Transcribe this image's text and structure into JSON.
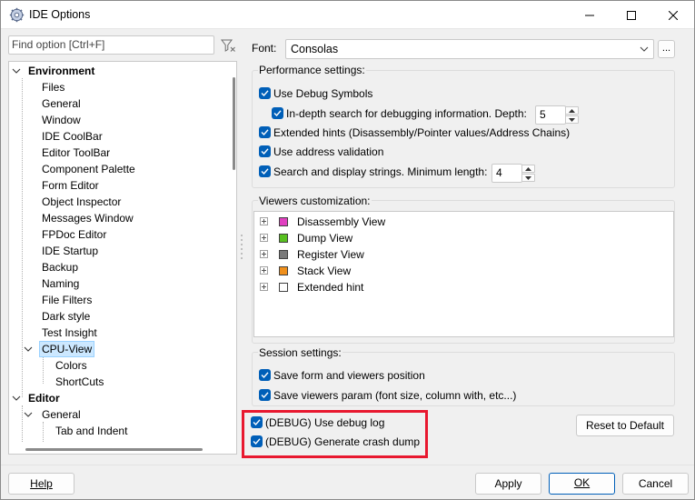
{
  "window": {
    "title": "IDE Options"
  },
  "left": {
    "search_placeholder": "Find option [Ctrl+F]",
    "tree": [
      {
        "label": "Environment",
        "level": 0,
        "bold": true,
        "expanded": true
      },
      {
        "label": "Files",
        "level": 1
      },
      {
        "label": "General",
        "level": 1
      },
      {
        "label": "Window",
        "level": 1
      },
      {
        "label": "IDE CoolBar",
        "level": 1
      },
      {
        "label": "Editor ToolBar",
        "level": 1
      },
      {
        "label": "Component Palette",
        "level": 1
      },
      {
        "label": "Form Editor",
        "level": 1
      },
      {
        "label": "Object Inspector",
        "level": 1
      },
      {
        "label": "Messages Window",
        "level": 1
      },
      {
        "label": "FPDoc Editor",
        "level": 1
      },
      {
        "label": "IDE Startup",
        "level": 1
      },
      {
        "label": "Backup",
        "level": 1
      },
      {
        "label": "Naming",
        "level": 1
      },
      {
        "label": "File Filters",
        "level": 1
      },
      {
        "label": "Dark style",
        "level": 1
      },
      {
        "label": "Test Insight",
        "level": 1
      },
      {
        "label": "CPU-View",
        "level": 1,
        "expanded": true,
        "selected": true
      },
      {
        "label": "Colors",
        "level": 2
      },
      {
        "label": "ShortCuts",
        "level": 2
      },
      {
        "label": "Editor",
        "level": 0,
        "bold": true,
        "expanded": true
      },
      {
        "label": "General",
        "level": 1,
        "expanded": true
      },
      {
        "label": "Tab and Indent",
        "level": 2
      }
    ]
  },
  "font": {
    "label": "Font:",
    "value": "Consolas",
    "more_label": "..."
  },
  "performance": {
    "title": "Performance settings:",
    "use_debug_symbols": "Use Debug Symbols",
    "indepth": "In-depth search for debugging information. Depth:",
    "depth_value": "5",
    "extended_hints": "Extended hints (Disassembly/Pointer values/Address Chains)",
    "use_address_validation": "Use address validation",
    "search_strings": "Search and display strings. Minimum length:",
    "min_length_value": "4"
  },
  "viewers": {
    "title": "Viewers customization:",
    "items": [
      {
        "label": "Disassembly View",
        "color": "#e040c0"
      },
      {
        "label": "Dump View",
        "color": "#58c020"
      },
      {
        "label": "Register View",
        "color": "#7a7a7a"
      },
      {
        "label": "Stack View",
        "color": "#f0901c"
      },
      {
        "label": "Extended hint",
        "color": "#ffffff"
      }
    ]
  },
  "session": {
    "title": "Session settings:",
    "save_form": "Save form and viewers position",
    "save_viewers_param": "Save viewers param (font size, column with, etc...)"
  },
  "debug": {
    "use_debug_log": "(DEBUG) Use debug log",
    "crash_dump": "(DEBUG) Generate crash dump"
  },
  "buttons": {
    "reset": "Reset to Default",
    "help": "Help",
    "apply": "Apply",
    "ok": "OK",
    "cancel": "Cancel"
  },
  "colors": {
    "accent": "#005fb8",
    "highlight_border": "#e8182f",
    "selection_bg": "#cce8ff"
  }
}
